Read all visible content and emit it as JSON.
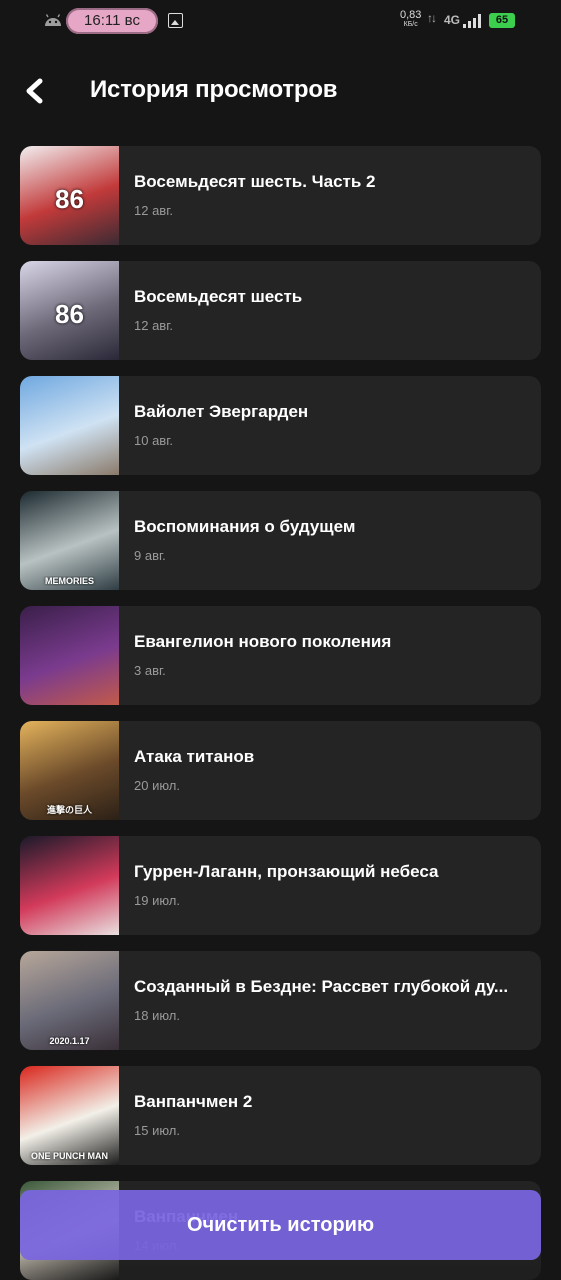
{
  "status_bar": {
    "time": "16:11 вс",
    "net_speed": "0,83",
    "net_speed_unit": "КБ/с",
    "network": "4G",
    "battery": "65"
  },
  "header": {
    "title": "История просмотров"
  },
  "items": [
    {
      "title": "Восемьдесят шесть. Часть 2",
      "date": "12 авг.",
      "poster_text": "86",
      "colors": [
        "#f2eef0",
        "#c23a3a",
        "#3b2b33"
      ]
    },
    {
      "title": "Восемьдесят шесть",
      "date": "12 авг.",
      "poster_text": "86",
      "colors": [
        "#d9d6e8",
        "#6f6a7a",
        "#2a2838"
      ]
    },
    {
      "title": "Вайолет Эвергарден",
      "date": "10 авг.",
      "poster_text": "",
      "colors": [
        "#6fa8e0",
        "#cfe2f3",
        "#8a7a6a"
      ]
    },
    {
      "title": "Воспоминания о будущем",
      "date": "9 авг.",
      "poster_text": "MEMORIES",
      "colors": [
        "#1c2a30",
        "#b9c2c2",
        "#2f3e44"
      ]
    },
    {
      "title": "Евангелион нового поколения",
      "date": "3 авг.",
      "poster_text": "",
      "colors": [
        "#3a1f4a",
        "#7a3b8e",
        "#c25a4a"
      ]
    },
    {
      "title": "Атака титанов",
      "date": "20 июл.",
      "poster_text": "進撃の巨人",
      "colors": [
        "#e3b35c",
        "#6b4a2a",
        "#2b2016"
      ]
    },
    {
      "title": "Гуррен-Лаганн, пронзающий небеса",
      "date": "19 июл.",
      "poster_text": "",
      "colors": [
        "#1a1a2a",
        "#d23a5a",
        "#e8e0e0"
      ]
    },
    {
      "title": "Созданный в Бездне: Рассвет глубокой ду...",
      "date": "18 июл.",
      "poster_text": "2020.1.17",
      "colors": [
        "#b7a79a",
        "#6a6a78",
        "#3a3038"
      ]
    },
    {
      "title": "Ванпанчмен 2",
      "date": "15 июл.",
      "poster_text": "ONE PUNCH MAN",
      "colors": [
        "#d9261c",
        "#f2f0e8",
        "#1c1c1c"
      ]
    },
    {
      "title": "Ванпанчмен",
      "date": "14 июл.",
      "poster_text": "",
      "colors": [
        "#3a5a3a",
        "#e8e0d0",
        "#1c1c1c"
      ]
    }
  ],
  "actions": {
    "clear_label": "Очистить историю"
  }
}
